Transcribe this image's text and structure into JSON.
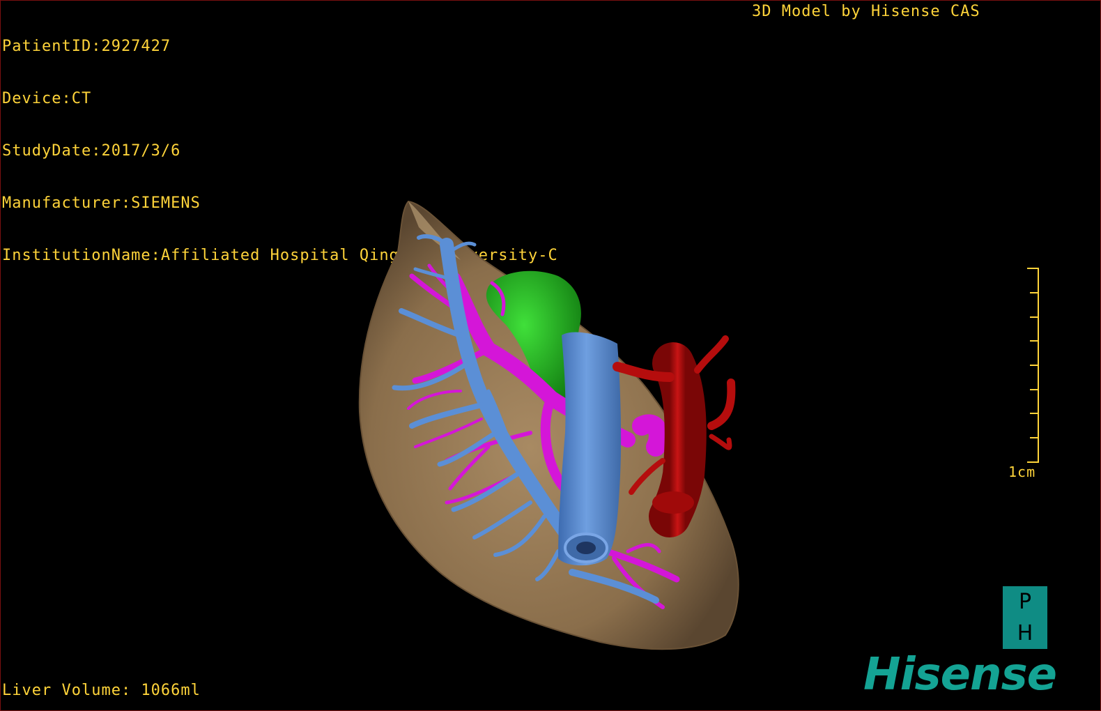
{
  "overlay": {
    "patient_id": "PatientID:2927427",
    "device": "Device:CT",
    "study_date": "StudyDate:2017/3/6",
    "manufacturer": "Manufacturer:SIEMENS",
    "institution": "InstitutionName:Affiliated Hospital Qingdao University-C",
    "credit": "3D Model by Hisense CAS",
    "liver_volume": "Liver Volume: 1066ml"
  },
  "scale": {
    "label": "1cm"
  },
  "logo": {
    "ph_top": "P",
    "ph_bottom": "H",
    "brand": "Hisense"
  },
  "model": {
    "structures": [
      {
        "name": "liver",
        "color": "#8a6e4b"
      },
      {
        "name": "portal-vein",
        "color": "#d416d8"
      },
      {
        "name": "hepatic-vein",
        "color": "#5b8fd6"
      },
      {
        "name": "tumor",
        "color": "#22b41e"
      },
      {
        "name": "inferior-vena-cava",
        "color": "#5b8fd6"
      },
      {
        "name": "aorta",
        "color": "#b50d0d"
      }
    ]
  },
  "colors": {
    "overlay_text": "#ffd43a",
    "brand": "#14a394",
    "viewport_border": "#7a1010"
  }
}
